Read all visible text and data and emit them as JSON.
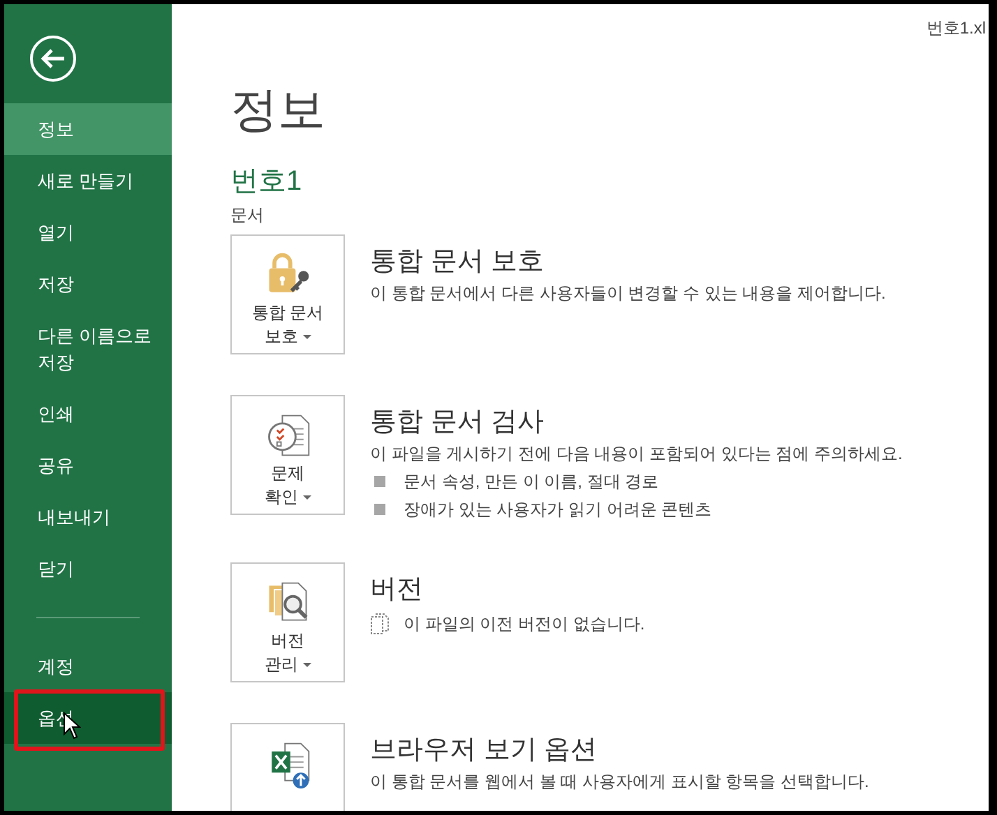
{
  "file_name": "번호1.xl",
  "sidebar": {
    "items": [
      {
        "label": "정보",
        "selected": true,
        "highlighted": false
      },
      {
        "label": "새로 만들기",
        "selected": false,
        "highlighted": false
      },
      {
        "label": "열기",
        "selected": false,
        "highlighted": false
      },
      {
        "label": "저장",
        "selected": false,
        "highlighted": false
      },
      {
        "label": "다른 이름으로 저장",
        "selected": false,
        "highlighted": false
      },
      {
        "label": "인쇄",
        "selected": false,
        "highlighted": false
      },
      {
        "label": "공유",
        "selected": false,
        "highlighted": false
      },
      {
        "label": "내보내기",
        "selected": false,
        "highlighted": false
      },
      {
        "label": "닫기",
        "selected": false,
        "highlighted": false
      }
    ],
    "bottom_items": [
      {
        "label": "계정",
        "selected": false,
        "highlighted": false
      },
      {
        "label": "옵션",
        "selected": false,
        "highlighted": true
      }
    ]
  },
  "page_title": "정보",
  "document_name": "번호1",
  "document_location": "문서",
  "sections": [
    {
      "kind": "protect",
      "button_lines": [
        "통합 문서",
        "보호"
      ],
      "title": "통합 문서 보호",
      "description": "이 통합 문서에서 다른 사용자들이 변경할 수 있는 내용을 제어합니다."
    },
    {
      "kind": "inspect",
      "button_lines": [
        "문제",
        "확인"
      ],
      "title": "통합 문서 검사",
      "description": "이 파일을 게시하기 전에 다음 내용이 포함되어 있다는 점에 주의하세요.",
      "bullets": [
        "문서 속성, 만든 이 이름, 절대 경로",
        "장애가 있는 사용자가 읽기 어려운 콘텐츠"
      ]
    },
    {
      "kind": "versions",
      "button_lines": [
        "버전",
        "관리"
      ],
      "title": "버전",
      "note": "이 파일의 이전 버전이 없습니다."
    },
    {
      "kind": "browser",
      "title": "브라우저 보기 옵션",
      "description": "이 통합 문서를 웹에서 볼 때 사용자에게 표시할 항목을 선택합니다."
    }
  ]
}
